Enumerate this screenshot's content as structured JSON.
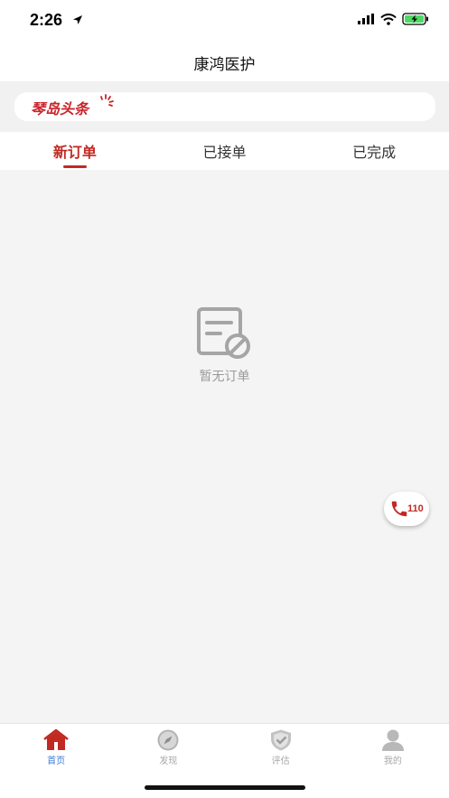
{
  "status_bar": {
    "time": "2:26"
  },
  "navbar": {
    "title": "康鸿医护"
  },
  "news_banner": {
    "logo_text": "琴岛头条",
    "brand_color": "#c9232b"
  },
  "tabs": [
    {
      "label": "新订单",
      "active": true
    },
    {
      "label": "已接单",
      "active": false
    },
    {
      "label": "已完成",
      "active": false
    }
  ],
  "empty_state": {
    "icon": "empty-order-icon",
    "text": "暂无订单"
  },
  "call_button": {
    "number": "110",
    "icon": "phone-icon"
  },
  "bottom_tabs": [
    {
      "label": "首页",
      "icon": "home-icon",
      "active": true
    },
    {
      "label": "发现",
      "icon": "compass-icon",
      "active": false
    },
    {
      "label": "评估",
      "icon": "shield-check-icon",
      "active": false
    },
    {
      "label": "我的",
      "icon": "user-icon",
      "active": false
    }
  ],
  "colors": {
    "accent": "#c12a22",
    "active_tab_label": "#3a7bd5",
    "background": "#f4f4f4"
  }
}
